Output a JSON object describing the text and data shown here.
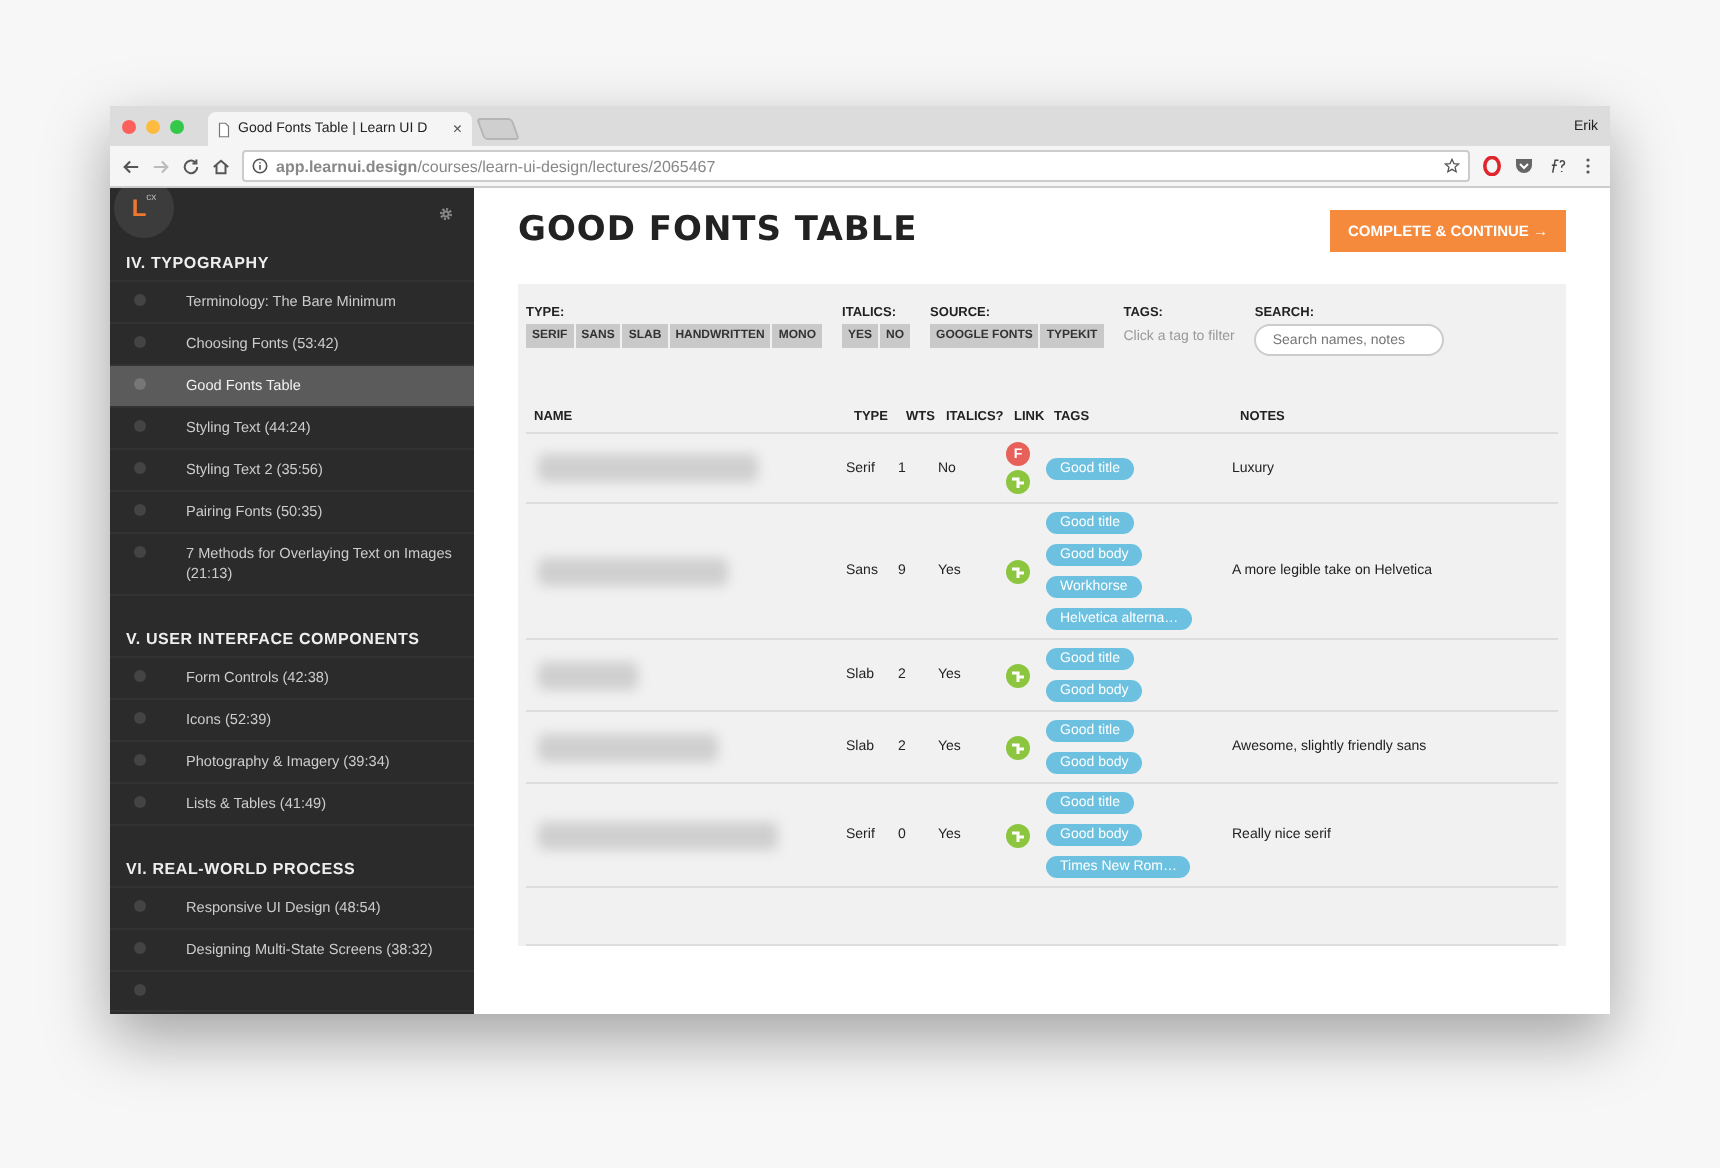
{
  "browser": {
    "tab_title": "Good Fonts Table | Learn UI D",
    "tab_close": "×",
    "user": "Erik",
    "url": "**app.learnui.design**/courses/learn-ui-design/lectures/2065467"
  },
  "sidebar": {
    "logo": "L",
    "logo_badge": "cx",
    "sections": [
      {
        "title": "IV. TYPOGRAPHY",
        "items": [
          {
            "label": "Terminology: The Bare Minimum",
            "selected": false
          },
          {
            "label": "Choosing Fonts (53:42)",
            "selected": false
          },
          {
            "label": "Good Fonts Table",
            "selected": true
          },
          {
            "label": "Styling Text (44:24)",
            "selected": false
          },
          {
            "label": "Styling Text 2 (35:56)",
            "selected": false
          },
          {
            "label": "Pairing Fonts (50:35)",
            "selected": false
          },
          {
            "label": "7 Methods for Overlaying Text on Images (21:13)",
            "selected": false
          }
        ]
      },
      {
        "title": "V. USER INTERFACE COMPONENTS",
        "items": [
          {
            "label": "Form Controls (42:38)",
            "selected": false
          },
          {
            "label": "Icons (52:39)",
            "selected": false
          },
          {
            "label": "Photography & Imagery (39:34)",
            "selected": false
          },
          {
            "label": "Lists & Tables (41:49)",
            "selected": false
          }
        ]
      },
      {
        "title": "VI. REAL-WORLD PROCESS",
        "items": [
          {
            "label": "Responsive UI Design (48:54)",
            "selected": false
          },
          {
            "label": "Designing Multi-State Screens (38:32)",
            "selected": false
          }
        ]
      }
    ]
  },
  "page": {
    "title": "GOOD FONTS TABLE",
    "button": "COMPLETE & CONTINUE →"
  },
  "filters": {
    "groups": [
      {
        "label": "TYPE:",
        "options": [
          "SERIF",
          "SANS",
          "SLAB",
          "HANDWRITTEN",
          "MONO"
        ]
      },
      {
        "label": "ITALICS:",
        "options": [
          "YES",
          "NO"
        ]
      },
      {
        "label": "SOURCE:",
        "options": [
          "GOOGLE FONTS",
          "TYPEKIT"
        ]
      }
    ],
    "tags": {
      "label": "TAGS:",
      "hint": "Click a tag to filter"
    },
    "search": {
      "label": "SEARCH:",
      "placeholder": "Search names, notes"
    }
  },
  "table": {
    "columns": [
      "NAME",
      "TYPE",
      "WTS",
      "ITALICS?",
      "LINK",
      "TAGS",
      "NOTES"
    ],
    "rows": [
      {
        "type": "Serif",
        "weights": "1",
        "italics": "No",
        "links": [
          {
            "kind": "letter",
            "label": "F",
            "color": "#e8605a"
          },
          {
            "kind": "icon",
            "color": "#8cc63f"
          }
        ],
        "tags": [
          "Good title"
        ],
        "notes": "Luxury"
      },
      {
        "type": "Sans",
        "weights": "9",
        "italics": "Yes",
        "links": [
          {
            "kind": "icon",
            "color": "#8cc63f"
          }
        ],
        "tags": [
          "Good title",
          "Good body",
          "Workhorse",
          "Helvetica alterna…"
        ],
        "notes": "A more legible take on Helvetica"
      },
      {
        "type": "Slab",
        "weights": "2",
        "italics": "Yes",
        "links": [
          {
            "kind": "icon",
            "color": "#8cc63f"
          }
        ],
        "tags": [
          "Good title",
          "Good body"
        ],
        "notes": ""
      },
      {
        "type": "Slab",
        "weights": "2",
        "italics": "Yes",
        "links": [
          {
            "kind": "icon",
            "color": "#8cc63f"
          }
        ],
        "tags": [
          "Good title",
          "Good body"
        ],
        "notes": "Awesome, slightly friendly sans"
      },
      {
        "type": "Serif",
        "weights": "0",
        "italics": "Yes",
        "links": [
          {
            "kind": "icon",
            "color": "#8cc63f"
          }
        ],
        "tags": [
          "Good title",
          "Good body",
          "Times New Rom…"
        ],
        "notes": "Really nice serif"
      }
    ]
  }
}
